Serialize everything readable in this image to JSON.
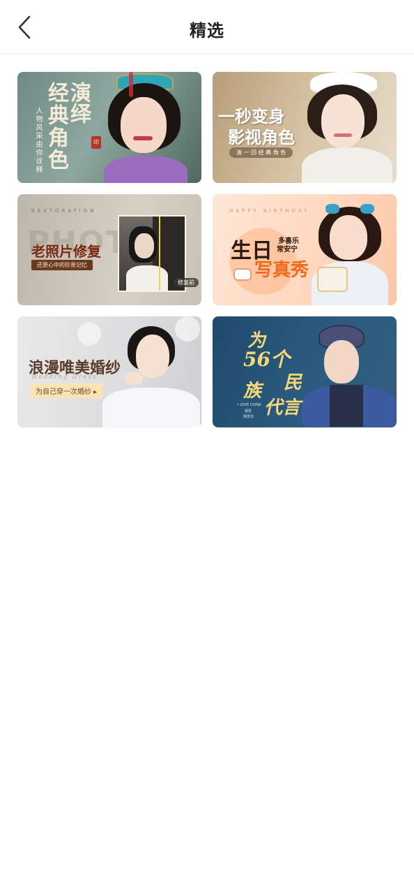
{
  "header": {
    "title": "精选",
    "back_icon": "chevron-left-icon"
  },
  "cards": [
    {
      "id": "classic-roles",
      "title_col1": "演绎",
      "title_col2": "经典角色",
      "subtitle": "人物风采由你诠释",
      "seal": "印",
      "colors": {
        "bg": "#6f8a86",
        "text": "#f4ecd7"
      }
    },
    {
      "id": "transform",
      "title_line1": "一秒变身",
      "title_line2": "影视角色",
      "tag": "演 一 回 经 典 角 色",
      "colors": {
        "bg": "#d7c3a4",
        "text": "#ffffff"
      }
    },
    {
      "id": "restore",
      "eyebrow": "RESTORATION",
      "watermark": "PHOTO",
      "title": "老照片修复",
      "subtitle": "还原心中的珍贵记忆",
      "badge": "修复前",
      "colors": {
        "title": "#7a2a12",
        "bar": "#6b3a1e"
      }
    },
    {
      "id": "birthday",
      "eyebrow": "HAPPY BIRTHDAY",
      "title_big": "生日",
      "small1": "多喜乐",
      "small2": "常安宁",
      "title_line2": "写真秀",
      "colors": {
        "accent": "#f06a1d",
        "dark": "#2a1a12"
      }
    },
    {
      "id": "wedding",
      "title": "浪漫唯美婚纱",
      "subtitle": "Wedding Dress",
      "cta": "为自己穿一次婚纱 ▸",
      "colors": {
        "title": "#5a3a2a",
        "cta_bg": "#fbe3b4"
      }
    },
    {
      "id": "ethnic",
      "title_line1": "为",
      "title_line2": "56个",
      "title_line3": "民",
      "title_line4": "族",
      "title_line5": "代言",
      "small1": "I LOVE CHINA",
      "small2": "我爱",
      "small3": "我爱你",
      "colors": {
        "bg": "#1f4a6a",
        "text": "#f5d77a"
      }
    }
  ]
}
